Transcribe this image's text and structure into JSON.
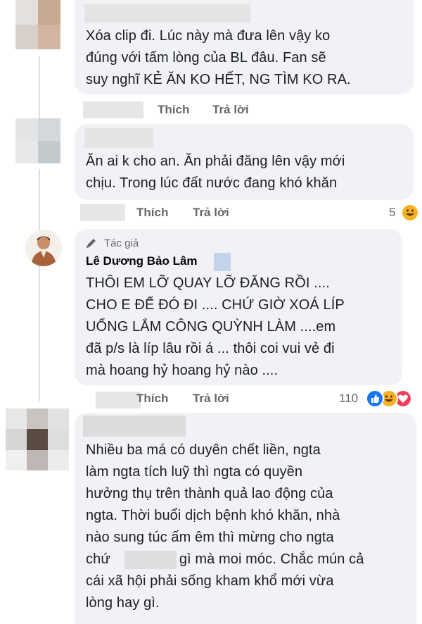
{
  "comments": [
    {
      "id": "c1",
      "text_lines": [
        "Xóa clip đi.  Lúc này mà đưa lên vậy ko",
        "đúng  với tấm lòng của  BL đâu.  Fan sẽ",
        "suy nghĩ KẺ ĂN KO HẾT,  NG TÌM KO RA."
      ],
      "like_label": "Thích",
      "reply_label": "Trả lời"
    },
    {
      "id": "c2",
      "text_lines": [
        "Ăn ai k cho an. Ăn phải đăng lên vậy mới",
        "chịu. Trong lúc đất nước đang khó khăn"
      ],
      "like_label": "Thích",
      "reply_label": "Trả lời",
      "reaction_count": "5",
      "reactions": [
        "haha-icon"
      ]
    },
    {
      "id": "c3",
      "badge": "Tác giả",
      "author": "Lê Dương Bảo Lâm",
      "text_lines": [
        "THÔI EM LỠ QUAY LỠ ĐĂNG RỒI ....",
        "CHO E ĐỂ ĐÓ ĐI .... CHỨ GIỜ XOÁ LÍP",
        "UỔNG LẮM CÔNG QUỲNH LÀM ....em",
        "đã p/s là líp lâu rồi á ... thôi coi vui vẻ đi",
        "mà hoang hỷ hoang hỷ nào ...."
      ],
      "like_label": "Thích",
      "reply_label": "Trả lời",
      "reaction_count": "110",
      "reactions": [
        "like-icon",
        "haha-icon",
        "love-icon"
      ]
    },
    {
      "id": "c4",
      "text_lines": [
        "Nhiều ba má có duyên chết liền, ngta",
        "làm ngta tích luỹ thì ngta có quyền",
        "hưởng thụ trên thành quả lao động của",
        "ngta. Thời buổi dịch bệnh khó khăn, nhà",
        "nào sung túc ấm êm thì mừng cho ngta"
      ],
      "line_pre": "chứ",
      "line_post": "gì mà moi móc. Chắc mún cả",
      "text_lines_end": [
        "cái xã hội phải sống kham khổ mới vừa",
        "lòng hay gì."
      ]
    }
  ],
  "colors": {
    "bubble": "#f0f2f5",
    "secondary_text": "#65676b",
    "like_blue": "#1877f2",
    "haha_yellow": "#f7b125",
    "love_red": "#f33e58"
  }
}
